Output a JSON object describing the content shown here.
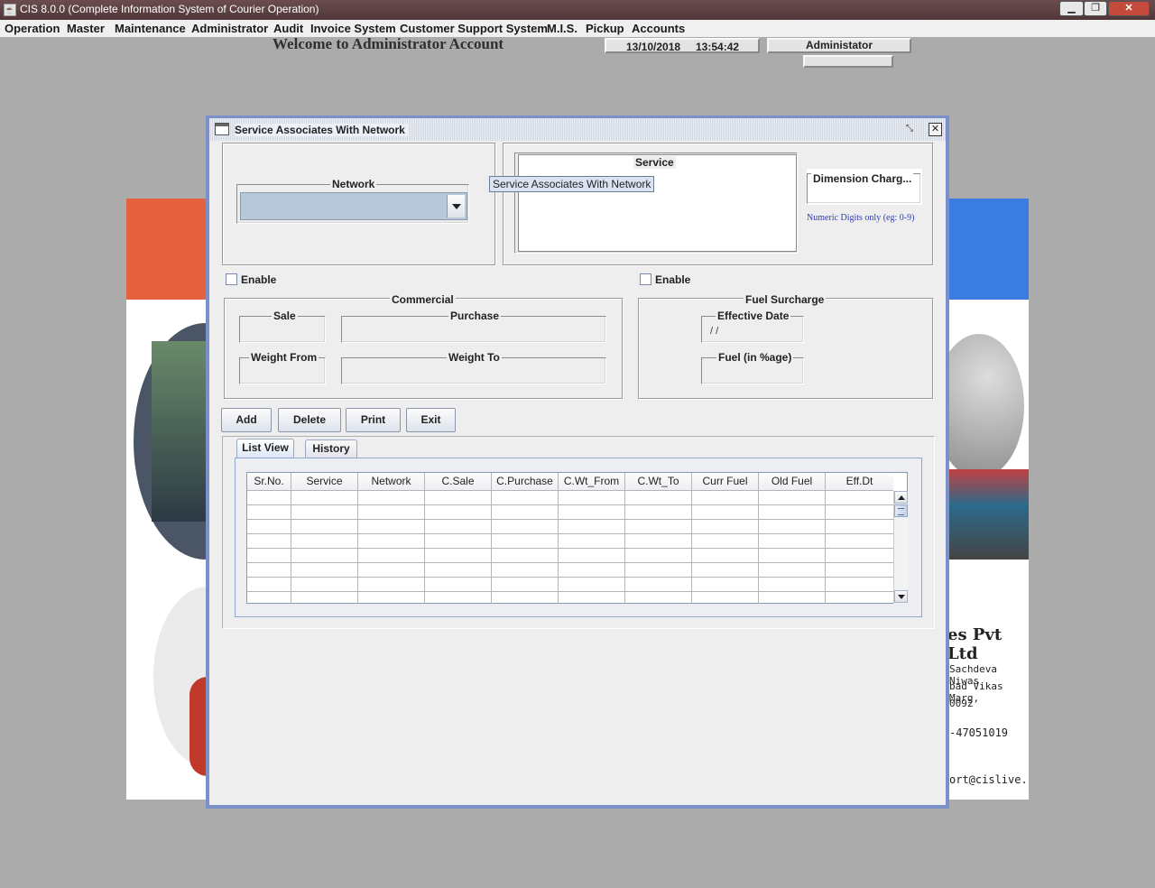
{
  "window": {
    "title": "CIS 8.0.0 (Complete Information System of Courier Operation)",
    "min_icon": "minimize-icon",
    "max_icon": "maximize-icon",
    "close_icon": "close-icon"
  },
  "menu": [
    "Operation",
    "Master",
    "Maintenance",
    "Administrator",
    "Audit",
    "Invoice System",
    "Customer Support System",
    "M.I.S.",
    "Pickup",
    "Accounts"
  ],
  "header": {
    "welcome": "Welcome to Administrator Account",
    "date": "13/10/2018",
    "time": "13:54:42",
    "user": "Administator"
  },
  "background": {
    "company": "es Pvt Ltd",
    "address_line1": "Sachdeva Niwas",
    "address_line2": "bad Vikas Marg,",
    "address_line3": "0092",
    "phone": "-47051019",
    "email": "ort@cislive.com",
    "colors": {
      "band_left": "#e5603d",
      "band_right": "#3b7ce0"
    }
  },
  "frame": {
    "title": "Service Associates With Network",
    "network_label": "Network",
    "network_value": "",
    "service_label": "Service",
    "tooltip": "Service Associates With Network",
    "dimension_label": "Dimension Charg...",
    "dimension_hint": "Numeric Digits only (eg: 0-9)",
    "enable_left": "Enable",
    "enable_right": "Enable",
    "commercial": {
      "title": "Commercial",
      "sale": "Sale",
      "purchase": "Purchase",
      "weight_from": "Weight From",
      "weight_to": "Weight To"
    },
    "fuel": {
      "title": "Fuel Surcharge",
      "effective_date": "Effective Date",
      "effective_date_value": "/ /",
      "fuel_pct": "Fuel (in %age)"
    },
    "buttons": {
      "add": "Add",
      "delete": "Delete",
      "print": "Print",
      "exit": "Exit"
    },
    "tabs": {
      "list_view": "List View",
      "history": "History"
    },
    "table": {
      "columns": [
        "Sr.No.",
        "Service",
        "Network",
        "C.Sale",
        "C.Purchase",
        "C.Wt_From",
        "C.Wt_To",
        "Curr Fuel",
        "Old Fuel",
        "Eff.Dt"
      ]
    },
    "accent": "#7b8fc8"
  }
}
